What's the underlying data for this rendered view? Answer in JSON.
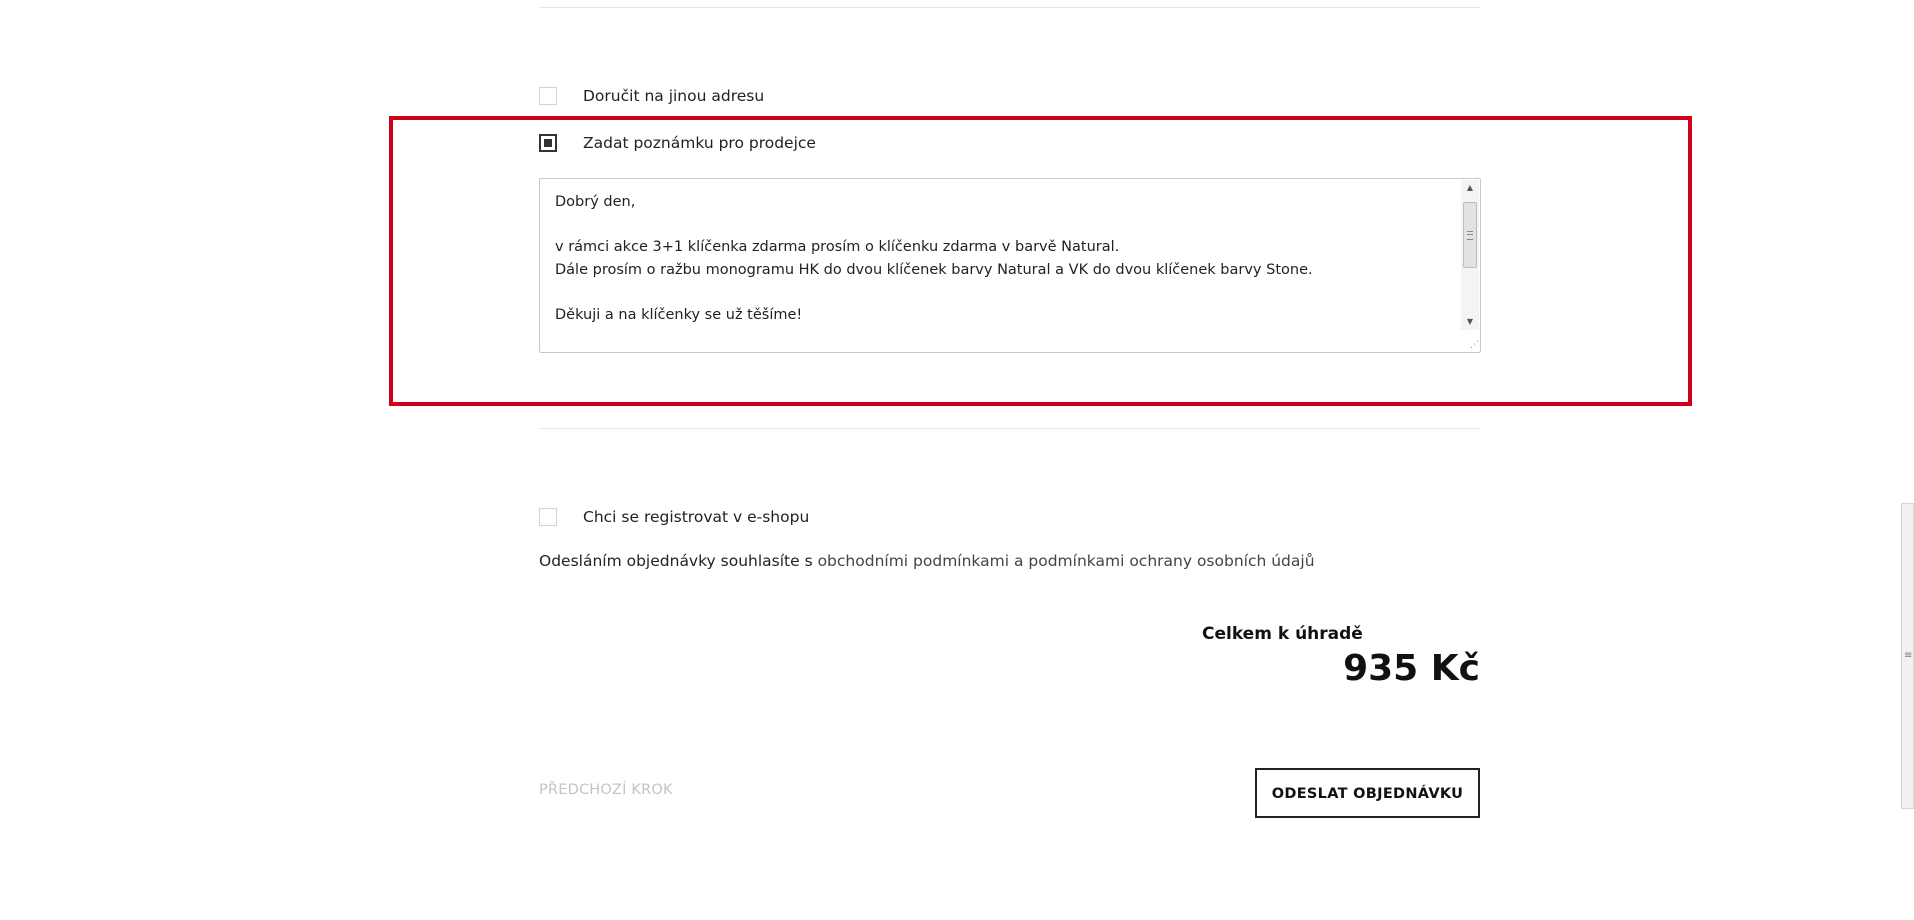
{
  "delivery": {
    "other_address_label": "Doručit na jinou adresu",
    "other_address_checked": false
  },
  "seller_note": {
    "label": "Zadat poznámku pro prodejce",
    "checked": true,
    "lines": [
      "Dobrý den,",
      "",
      "v rámci akce 3+1 klíčenka zdarma prosím o klíčenku zdarma v barvě Natural.",
      "Dále prosím o ražbu monogramu HK do dvou klíčenek barvy Natural a VK do dvou klíčenek barvy Stone.",
      "",
      "Děkuji a na klíčenky se už těšíme!"
    ]
  },
  "registration": {
    "label": "Chci se registrovat v e-shopu",
    "checked": false
  },
  "terms": {
    "prefix": "Odesláním objednávky souhlasíte s ",
    "link_terms": "obchodními podmínkami",
    "conjunction": " a ",
    "link_privacy": "podmínkami ochrany osobních údajů"
  },
  "total": {
    "label": "Celkem k úhradě",
    "amount": "935 Kč"
  },
  "actions": {
    "previous_step": "PŘEDCHOZÍ KROK",
    "submit": "ODESLAT OBJEDNÁVKU"
  },
  "colors": {
    "highlight": "#d0021b",
    "text": "#222222",
    "muted": "#c4c4c4"
  }
}
